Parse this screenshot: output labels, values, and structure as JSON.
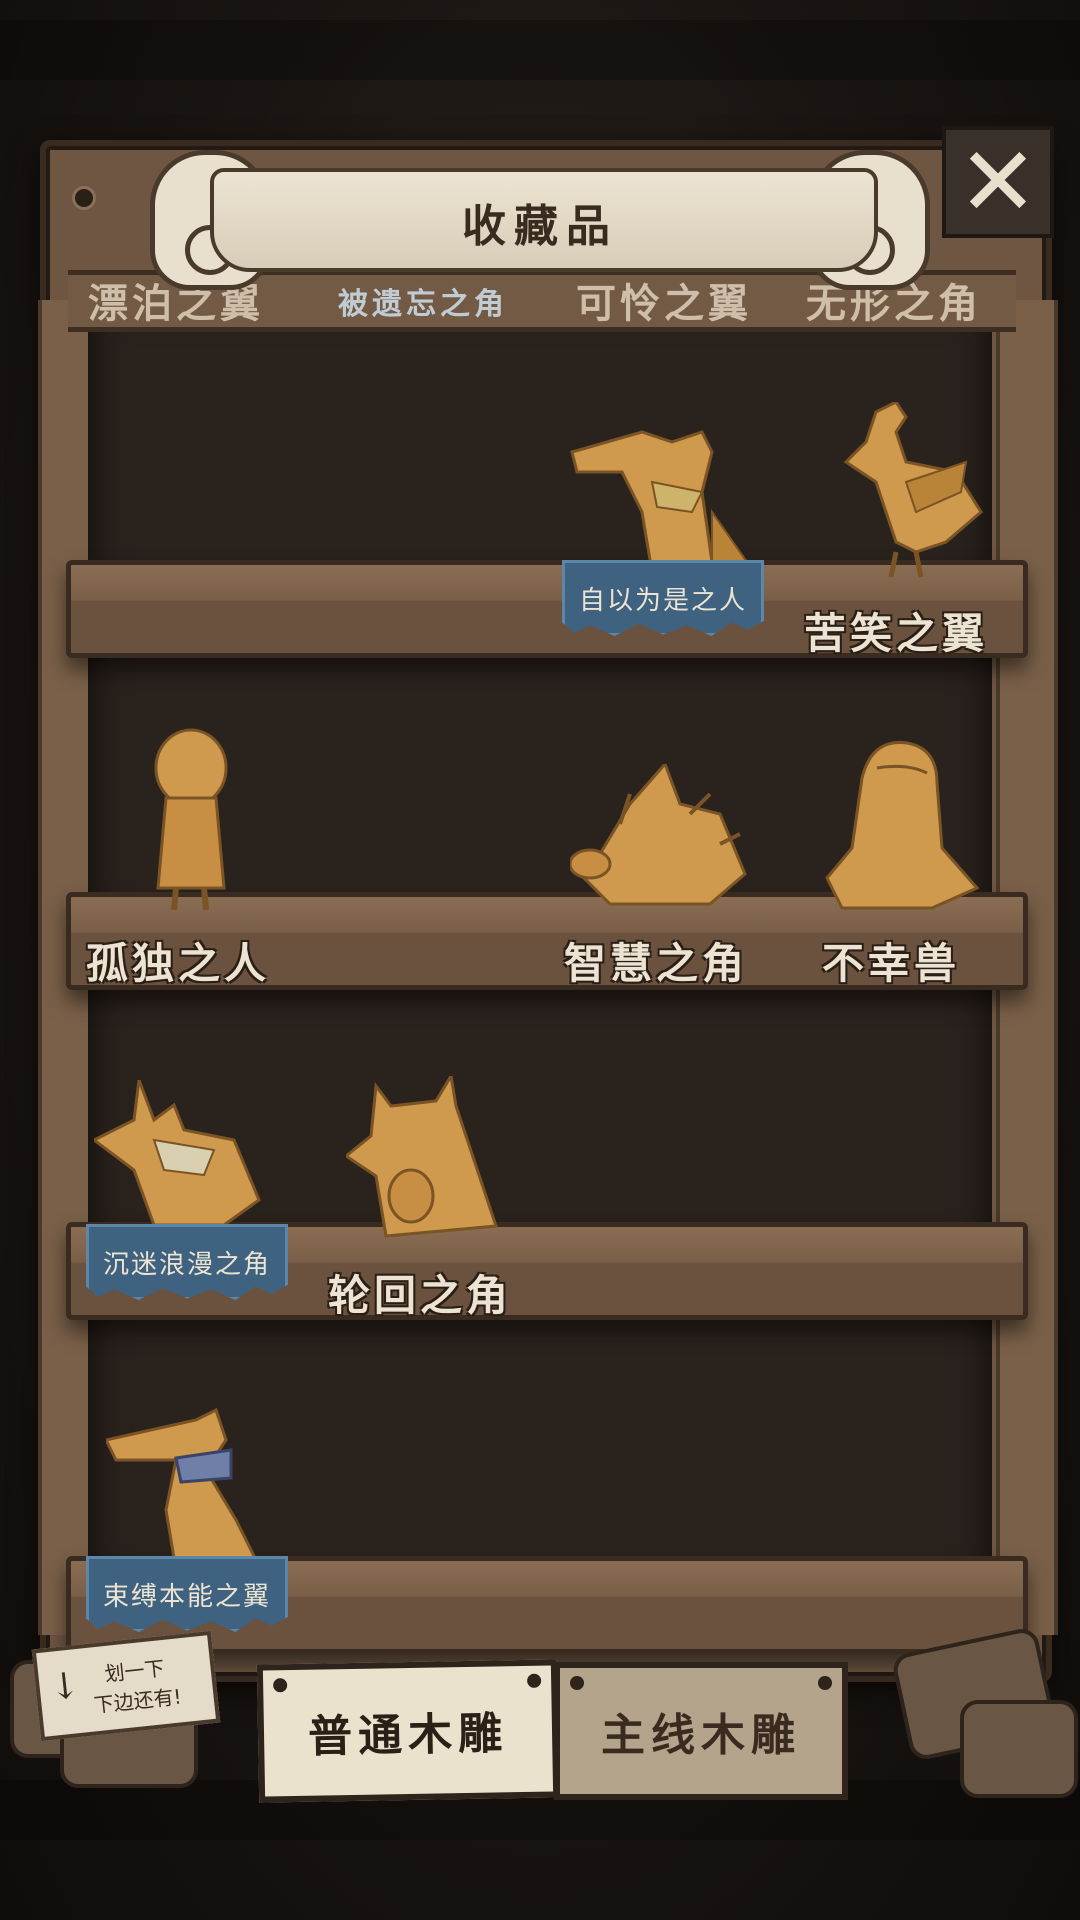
{
  "header": {
    "title": "收藏品"
  },
  "close_button": {
    "glyph": "✕"
  },
  "top_row_partial": [
    "漂泊之翼",
    "被遗忘之角",
    "可怜之翼",
    "无形之角"
  ],
  "shelves": [
    {
      "items": [
        {
          "col": 2,
          "name": "自以为是之人",
          "badge": true,
          "figure": "tapir-scarf"
        },
        {
          "col": 3,
          "name": "苦笑之翼",
          "badge": false,
          "figure": "rooster"
        }
      ]
    },
    {
      "items": [
        {
          "col": 0,
          "name": "孤独之人",
          "badge": false,
          "figure": "girl"
        },
        {
          "col": 2,
          "name": "智慧之角",
          "badge": false,
          "figure": "tortoise"
        },
        {
          "col": 3,
          "name": "不幸兽",
          "badge": false,
          "figure": "seal"
        }
      ]
    },
    {
      "items": [
        {
          "col": 0,
          "name": "沉迷浪漫之角",
          "badge": true,
          "figure": "rhino-scarf"
        },
        {
          "col": 1,
          "name": "轮回之角",
          "badge": false,
          "figure": "ox"
        }
      ]
    },
    {
      "items": [
        {
          "col": 0,
          "name": "束缚本能之翼",
          "badge": true,
          "figure": "pelican"
        }
      ]
    }
  ],
  "hint": {
    "line1": "划一下",
    "line2": "下边还有!"
  },
  "tabs": [
    {
      "label": "普通木雕",
      "active": true
    },
    {
      "label": "主线木雕",
      "active": false
    }
  ],
  "colors": {
    "wood": "#d09a4e",
    "badge_blue": "#3e6280",
    "cabinet": "#6e5642"
  }
}
